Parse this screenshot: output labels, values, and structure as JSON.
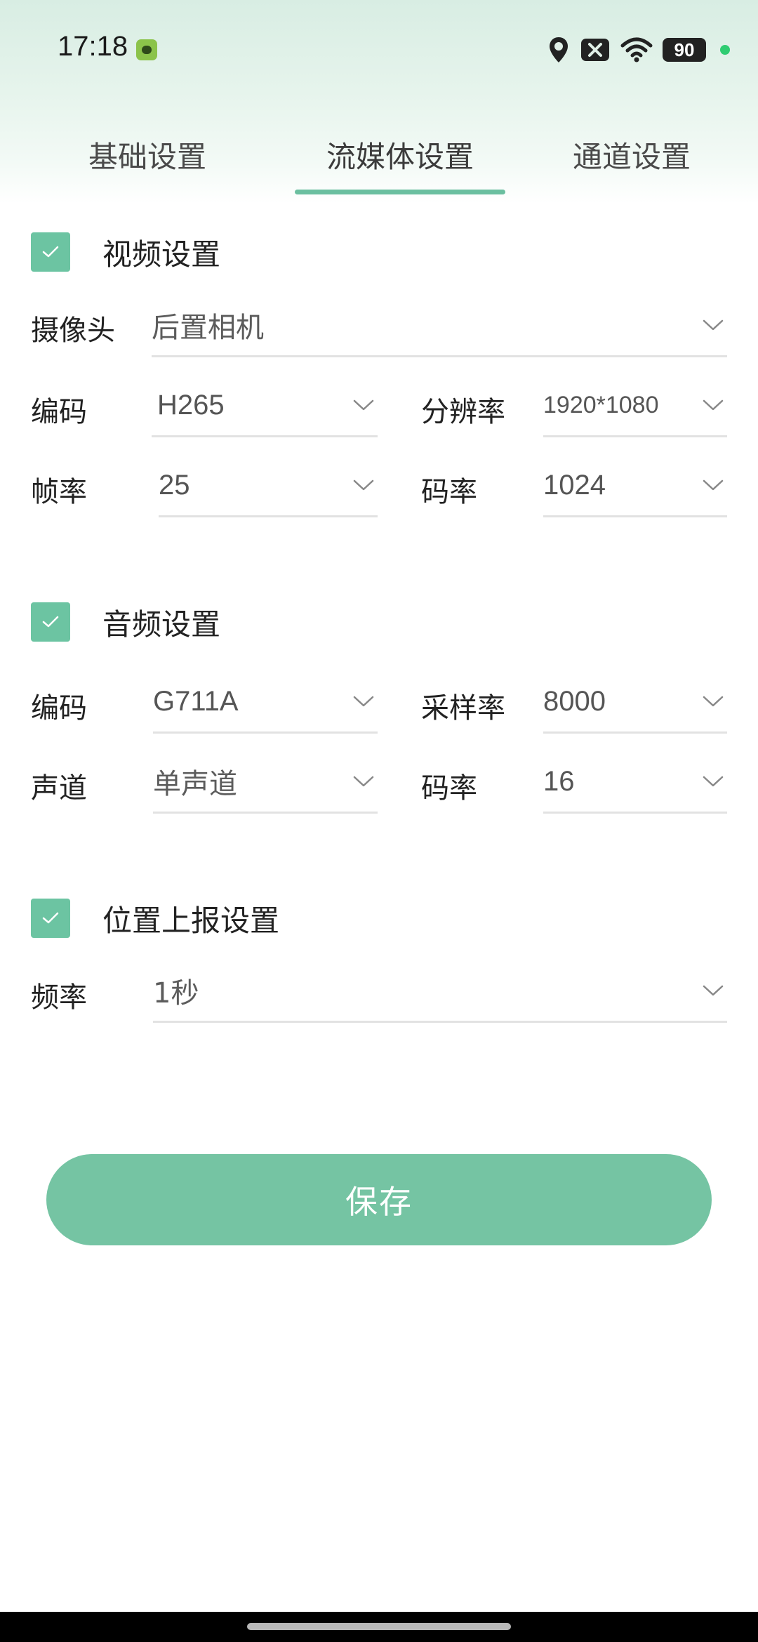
{
  "status_bar": {
    "time": "17:18",
    "battery": "90",
    "icons": [
      "app-notification-icon",
      "location-icon",
      "no-sim-icon",
      "wifi-icon",
      "battery-icon"
    ]
  },
  "tabs": [
    {
      "label": "基础设置",
      "active": false
    },
    {
      "label": "流媒体设置",
      "active": true
    },
    {
      "label": "通道设置",
      "active": false
    }
  ],
  "video": {
    "title": "视频设置",
    "checked": true,
    "camera_label": "摄像头",
    "camera_value": "后置相机",
    "codec_label": "编码",
    "codec_value": "H265",
    "resolution_label": "分辨率",
    "resolution_value": "1920*1080",
    "framerate_label": "帧率",
    "framerate_value": "25",
    "bitrate_label": "码率",
    "bitrate_value": "1024"
  },
  "audio": {
    "title": "音频设置",
    "checked": true,
    "codec_label": "编码",
    "codec_value": "G711A",
    "samplerate_label": "采样率",
    "samplerate_value": "8000",
    "channel_label": "声道",
    "channel_value": "单声道",
    "bitrate_label": "码率",
    "bitrate_value": "16"
  },
  "location": {
    "title": "位置上报设置",
    "checked": true,
    "frequency_label": "频率",
    "frequency_value": "1秒"
  },
  "save_label": "保存",
  "colors": {
    "accent": "#6cc4a2",
    "button": "#75c4a3",
    "tab_indicator": "#6bbfa0"
  }
}
